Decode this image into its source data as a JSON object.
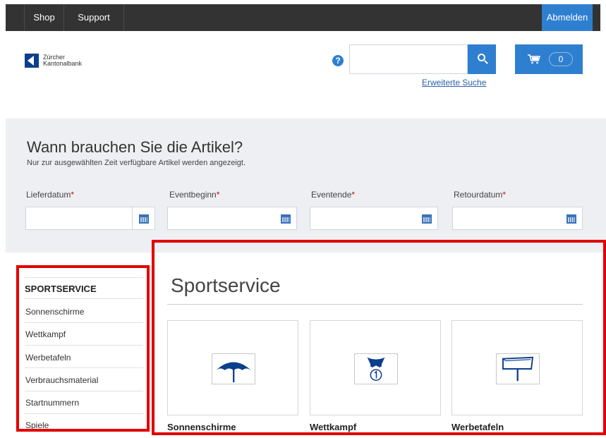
{
  "topnav": {
    "items": [
      "Shop",
      "Support"
    ],
    "logout_label": "Abmelden"
  },
  "logo": {
    "line1": "Zürcher",
    "line2": "Kantonalbank"
  },
  "header": {
    "help_symbol": "?",
    "search_placeholder": "",
    "advanced_search_label": "Erweiterte Suche",
    "cart_count": "0"
  },
  "dates": {
    "title": "Wann brauchen Sie die Artikel?",
    "subtitle": "Nur zur ausgewählten Zeit verfügbare Artikel werden angezeigt.",
    "fields": [
      {
        "label": "Lieferdatum",
        "required": "*"
      },
      {
        "label": "Eventbeginn",
        "required": "*"
      },
      {
        "label": "Eventende",
        "required": "*"
      },
      {
        "label": "Retourdatum",
        "required": "*"
      }
    ]
  },
  "sidebar": {
    "heading": "SPORTSERVICE",
    "items": [
      "Sonnenschirme",
      "Wettkampf",
      "Werbetafeln",
      "Verbrauchsmaterial",
      "Startnummern",
      "Spiele"
    ]
  },
  "content": {
    "title": "Sportservice",
    "cards": [
      {
        "label": "Sonnenschirme",
        "icon": "umbrella-icon"
      },
      {
        "label": "Wettkampf",
        "icon": "trophy-icon"
      },
      {
        "label": "Werbetafeln",
        "icon": "billboard-icon"
      }
    ]
  },
  "colors": {
    "accent": "#2f7fd0",
    "topbar": "#333333",
    "highlight": "#e00000",
    "icon_blue": "#0a3f8c"
  }
}
